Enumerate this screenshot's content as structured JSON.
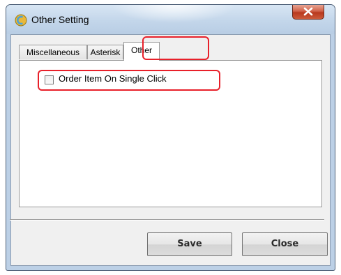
{
  "window": {
    "title": "Other Setting",
    "app_icon": "app-logo-icon",
    "close_icon": "close-x-icon"
  },
  "tabs": [
    {
      "label": "Miscellaneous",
      "selected": false
    },
    {
      "label": "Asterisk",
      "selected": false
    },
    {
      "label": "Other",
      "selected": true
    }
  ],
  "other_tab": {
    "option_label": "Order Item On Single Click",
    "option_checked": false
  },
  "buttons": {
    "save_label": "Save",
    "close_label": "Close"
  },
  "colors": {
    "highlight": "#e8202a",
    "close_button": "#c8452b",
    "frame": "#bcd0e6"
  }
}
